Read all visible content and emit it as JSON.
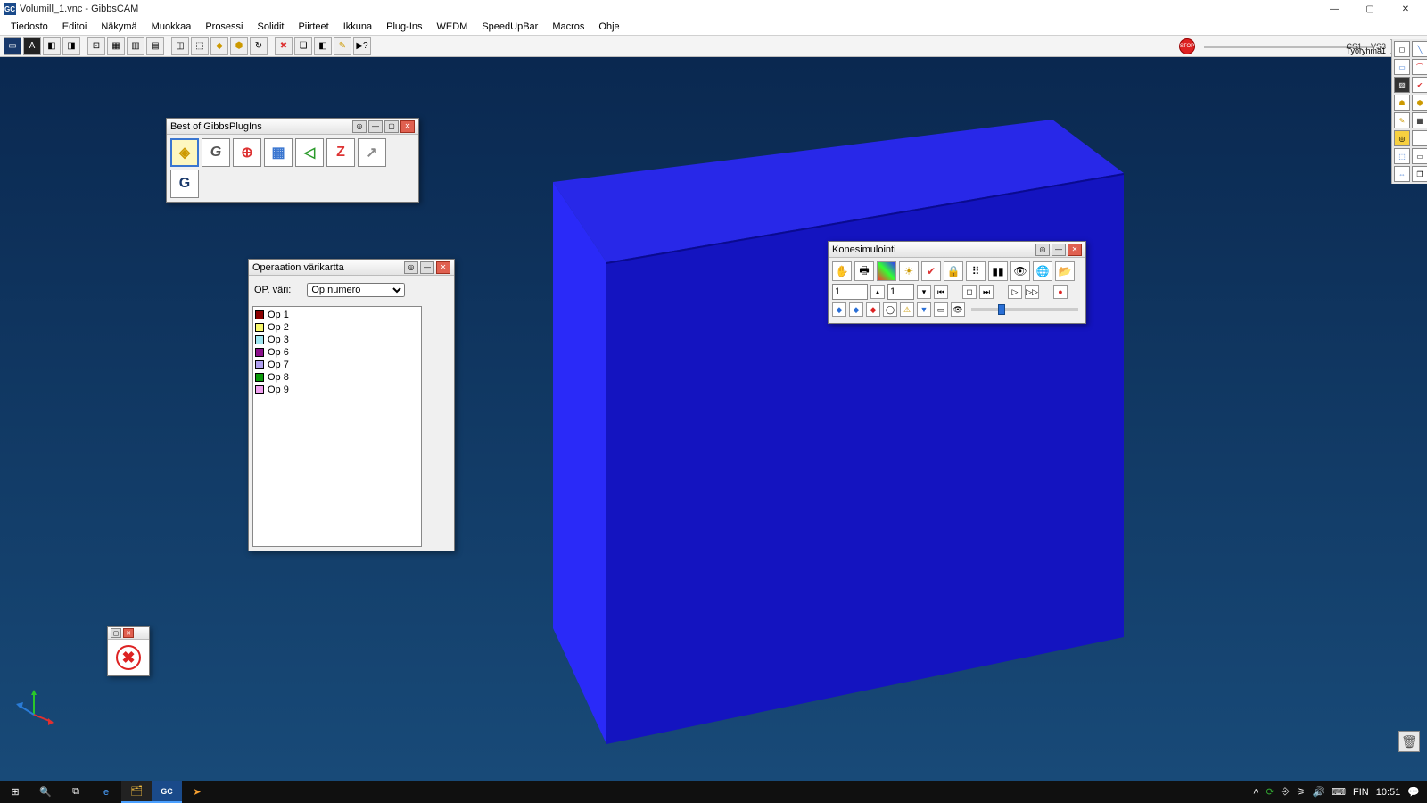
{
  "titlebar": {
    "app_icon_text": "GC",
    "title": "Volumill_1.vnc - GibbsCAM"
  },
  "menubar": {
    "items": [
      "Tiedosto",
      "Editoi",
      "Näkymä",
      "Muokkaa",
      "Prosessi",
      "Solidit",
      "Piirteet",
      "Ikkuna",
      "Plug-Ins",
      "WEDM",
      "SpeedUpBar",
      "Macros",
      "Ohje"
    ]
  },
  "toolbar_right": {
    "lines": [
      "CS1",
      "VS3",
      "Työryhmä1"
    ]
  },
  "stop_label": "STOP",
  "plugins_panel": {
    "title": "Best of GibbsPlugIns",
    "buttons": [
      "◈",
      "G",
      "⊕",
      "▦",
      "◁",
      "Z",
      "↗",
      "G"
    ]
  },
  "opcolor_panel": {
    "title": "Operaation värikartta",
    "field_label": "OP. väri:",
    "dropdown": "Op numero",
    "ops": [
      {
        "label": "Op 1",
        "color": "#8a0000"
      },
      {
        "label": "Op 2",
        "color": "#f7f76a"
      },
      {
        "label": "Op 3",
        "color": "#9fe7f2"
      },
      {
        "label": "Op 6",
        "color": "#8a0f8a"
      },
      {
        "label": "Op 7",
        "color": "#b0a0f0"
      },
      {
        "label": "Op 8",
        "color": "#0a9a0a"
      },
      {
        "label": "Op 9",
        "color": "#f0a0f0"
      }
    ]
  },
  "sim_panel": {
    "title": "Konesimulointi",
    "input1": "1",
    "input2": "1"
  },
  "taskbar": {
    "lang": "FIN",
    "time": "10:51"
  }
}
